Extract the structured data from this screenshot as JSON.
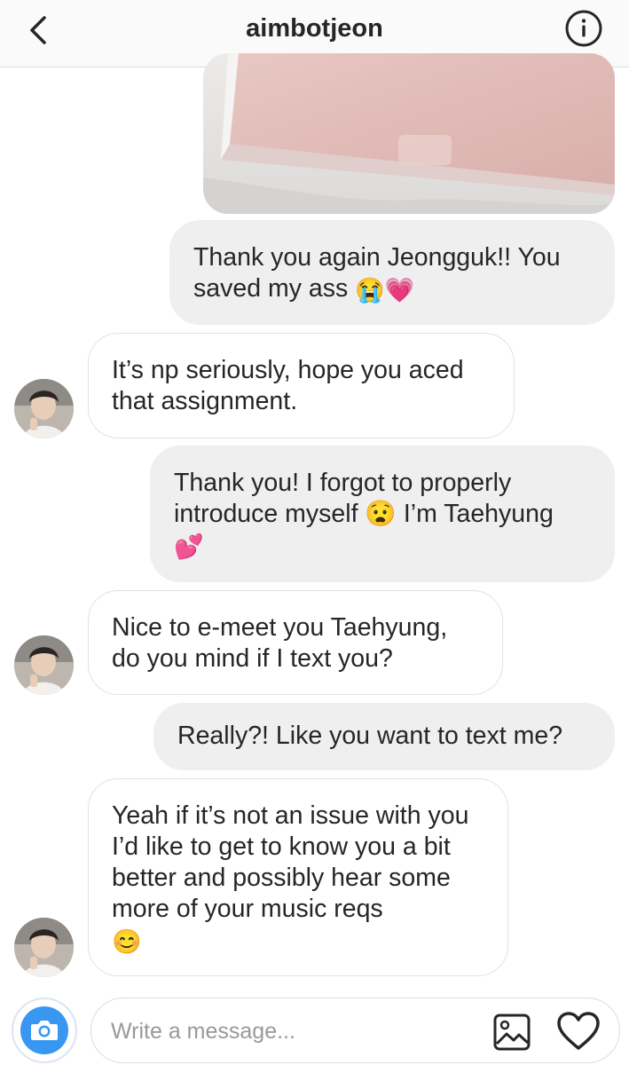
{
  "header": {
    "username": "aimbotjeon",
    "back_icon": "chevron-left-icon",
    "info_icon": "info-icon"
  },
  "messages": [
    {
      "type": "image",
      "direction": "out",
      "description_icon": "laptop-photo"
    },
    {
      "type": "text",
      "direction": "out",
      "text": "Thank you again Jeongguk!! You saved my ass",
      "emojis": "😭💗"
    },
    {
      "type": "text",
      "direction": "in",
      "text": "It’s np seriously, hope you aced that assignment."
    },
    {
      "type": "text",
      "direction": "out",
      "text": "Thank you! I forgot to properly introduce myself 😧 I’m Taehyung",
      "emojis": "💕"
    },
    {
      "type": "text",
      "direction": "in",
      "text": "Nice to e-meet you Taehyung, do you mind if I text you?"
    },
    {
      "type": "text",
      "direction": "out",
      "text": "Really?! Like you want to text me?"
    },
    {
      "type": "text",
      "direction": "in",
      "text": "Yeah if it’s not an issue with you I’d like to get to know you a bit better and possibly hear some more of your music reqs",
      "emojis": "😊"
    }
  ],
  "composer": {
    "placeholder": "Write a message...",
    "camera_icon": "camera-icon",
    "gallery_icon": "gallery-icon",
    "heart_icon": "heart-icon"
  },
  "colors": {
    "accent": "#3897f0",
    "outgoing_bubble": "#efefef",
    "incoming_border": "#e2e2e2",
    "header_bg": "#fafafa"
  }
}
